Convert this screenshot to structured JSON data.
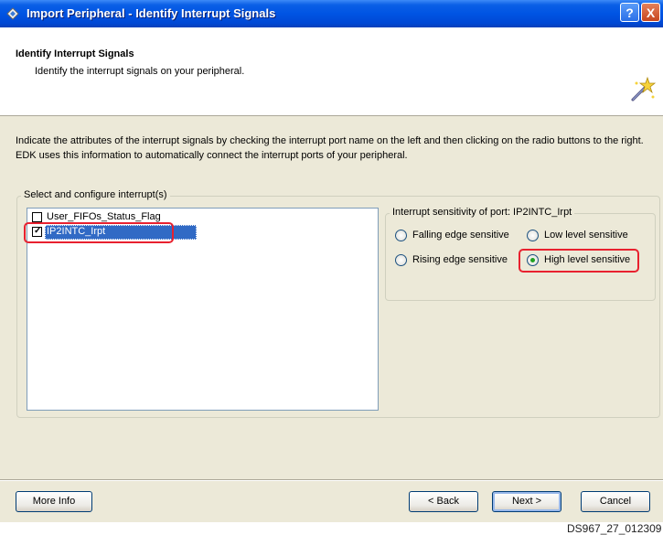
{
  "window": {
    "title": "Import Peripheral - Identify Interrupt Signals",
    "help_label": "?",
    "close_label": "X"
  },
  "header": {
    "title": "Identify Interrupt Signals",
    "subtitle": "Identify the interrupt signals on your peripheral."
  },
  "instructions": "Indicate the attributes of the interrupt signals by checking the interrupt port name on the left and then clicking on the radio buttons to the right. EDK uses this information to automatically connect the interrupt ports of your peripheral.",
  "interrupts": {
    "legend": "Select and configure interrupt(s)",
    "items": [
      {
        "label": "User_FIFOs_Status_Flag",
        "checked": false,
        "selected": false
      },
      {
        "label": "IP2INTC_Irpt",
        "checked": true,
        "selected": true
      }
    ]
  },
  "sensitivity": {
    "legend": "Interrupt sensitivity of port: IP2INTC_Irpt",
    "options": [
      {
        "label": "Falling edge sensitive",
        "selected": false
      },
      {
        "label": "Low level sensitive",
        "selected": false
      },
      {
        "label": "Rising edge sensitive",
        "selected": false
      },
      {
        "label": "High level sensitive",
        "selected": true
      }
    ]
  },
  "buttons": {
    "more_info": "More Info",
    "back": "< Back",
    "next": "Next >",
    "cancel": "Cancel"
  },
  "caption": "DS967_27_012309",
  "colors": {
    "title_bar": "#0054e3",
    "selection": "#316ac5",
    "highlight": "#e8212f",
    "radio_dot": "#21a121"
  }
}
